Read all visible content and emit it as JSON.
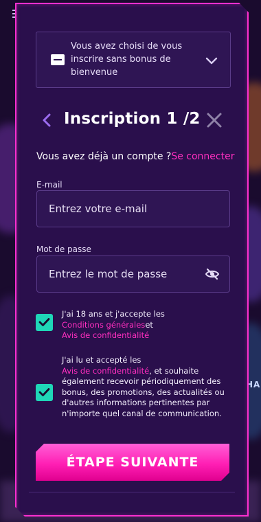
{
  "bonus": {
    "text": "Vous avez choisi de vous inscrire sans bonus de bienvenue",
    "icon": "no-bonus-icon"
  },
  "header": {
    "title": "Inscription 1 /2"
  },
  "account": {
    "question": "Vous avez déjà un compte ?",
    "login_link": "Se connecter"
  },
  "email": {
    "label": "E-mail",
    "placeholder": "Entrez votre e-mail",
    "value": ""
  },
  "password": {
    "label": "Mot de passe",
    "placeholder": "Entrez le mot de passe",
    "value": ""
  },
  "consent1": {
    "checked": true,
    "prefix": "J'ai 18 ans et j'accepte les",
    "terms_link": "Conditions générales",
    "and": "et",
    "privacy_link": "Avis de confidentialité"
  },
  "consent2": {
    "checked": true,
    "prefix": "J'ai lu et accepté les",
    "privacy_link": "Avis de confidentialité",
    "suffix": ", et souhaite également recevoir périodiquement des bonus, des promotions, des actualités ou d'autres informations pertinentes par n'importe quel canal de communication."
  },
  "next_button": {
    "label": "ÉTAPE SUIVANTE"
  },
  "background": {
    "side_hint": "HAL"
  },
  "colors": {
    "accent": "#ff2fbf",
    "border": "#ff2fd0",
    "check": "#1fd6b7",
    "panel": "#2a0f4c"
  }
}
